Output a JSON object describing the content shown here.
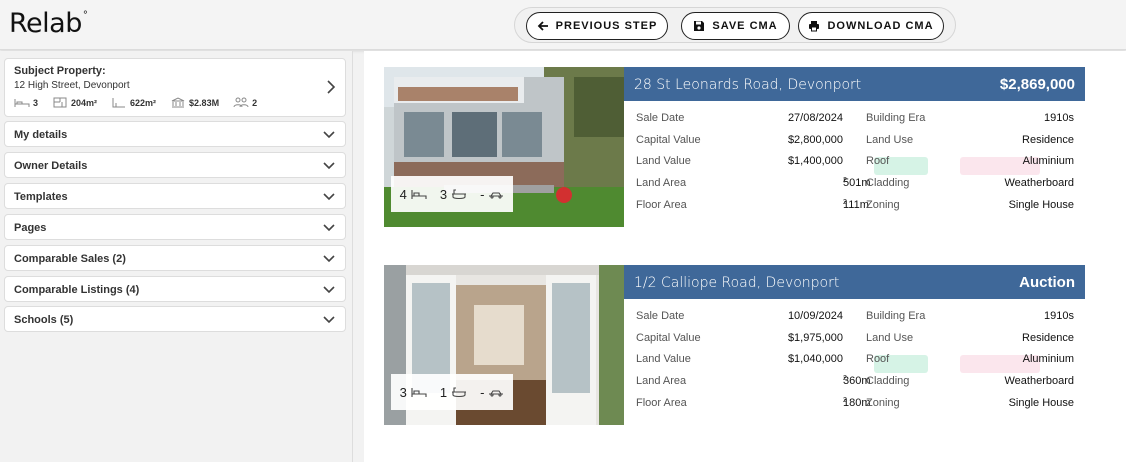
{
  "header": {
    "logo": "Relab",
    "logo_mark": "°",
    "buttons": {
      "previous_step": "PREVIOUS STEP",
      "save_cma": "SAVE CMA",
      "download_cma": "DOWNLOAD CMA"
    }
  },
  "sidebar": {
    "subject": {
      "label": "Subject Property:",
      "address": "12 High Street, Devonport",
      "bedrooms": "3",
      "floor_area": "204m²",
      "land_area": "622m²",
      "value": "$2.83M",
      "occupants": "2"
    },
    "sections": [
      "My details",
      "Owner Details",
      "Templates",
      "Pages",
      "Comparable Sales (2)",
      "Comparable Listings (4)",
      "Schools (5)"
    ]
  },
  "labels": {
    "sale_date": "Sale Date",
    "capital_value": "Capital Value",
    "land_value": "Land Value",
    "land_area": "Land Area",
    "floor_area": "Floor Area",
    "building_era": "Building Era",
    "land_use": "Land Use",
    "roof": "Roof",
    "cladding": "Cladding",
    "zoning": "Zoning",
    "parking_dash": "-"
  },
  "cards": [
    {
      "address": "28 St Leonards Road, Devonport",
      "price": "$2,869,000",
      "beds": "4",
      "baths": "3",
      "sale_date": "27/08/2024",
      "capital_value": "$2,800,000",
      "land_value": "$1,400,000",
      "land_area": "501m",
      "floor_area": "111m",
      "building_era": "1910s",
      "land_use": "Residence",
      "roof": "Aluminium",
      "cladding": "Weatherboard",
      "zoning": "Single House",
      "area_sup": "2"
    },
    {
      "address": "1/2 Calliope Road, Devonport",
      "price": "Auction",
      "beds": "3",
      "baths": "1",
      "sale_date": "10/09/2024",
      "capital_value": "$1,975,000",
      "land_value": "$1,040,000",
      "land_area": "360m",
      "floor_area": "180m",
      "building_era": "1910s",
      "land_use": "Residence",
      "roof": "Aluminium",
      "cladding": "Weatherboard",
      "zoning": "Single House",
      "area_sup": "2"
    }
  ],
  "colors": {
    "title_bar": "#3f6899",
    "ghost_green": "#6bd3a4",
    "ghost_pink": "#f2a6c0"
  }
}
